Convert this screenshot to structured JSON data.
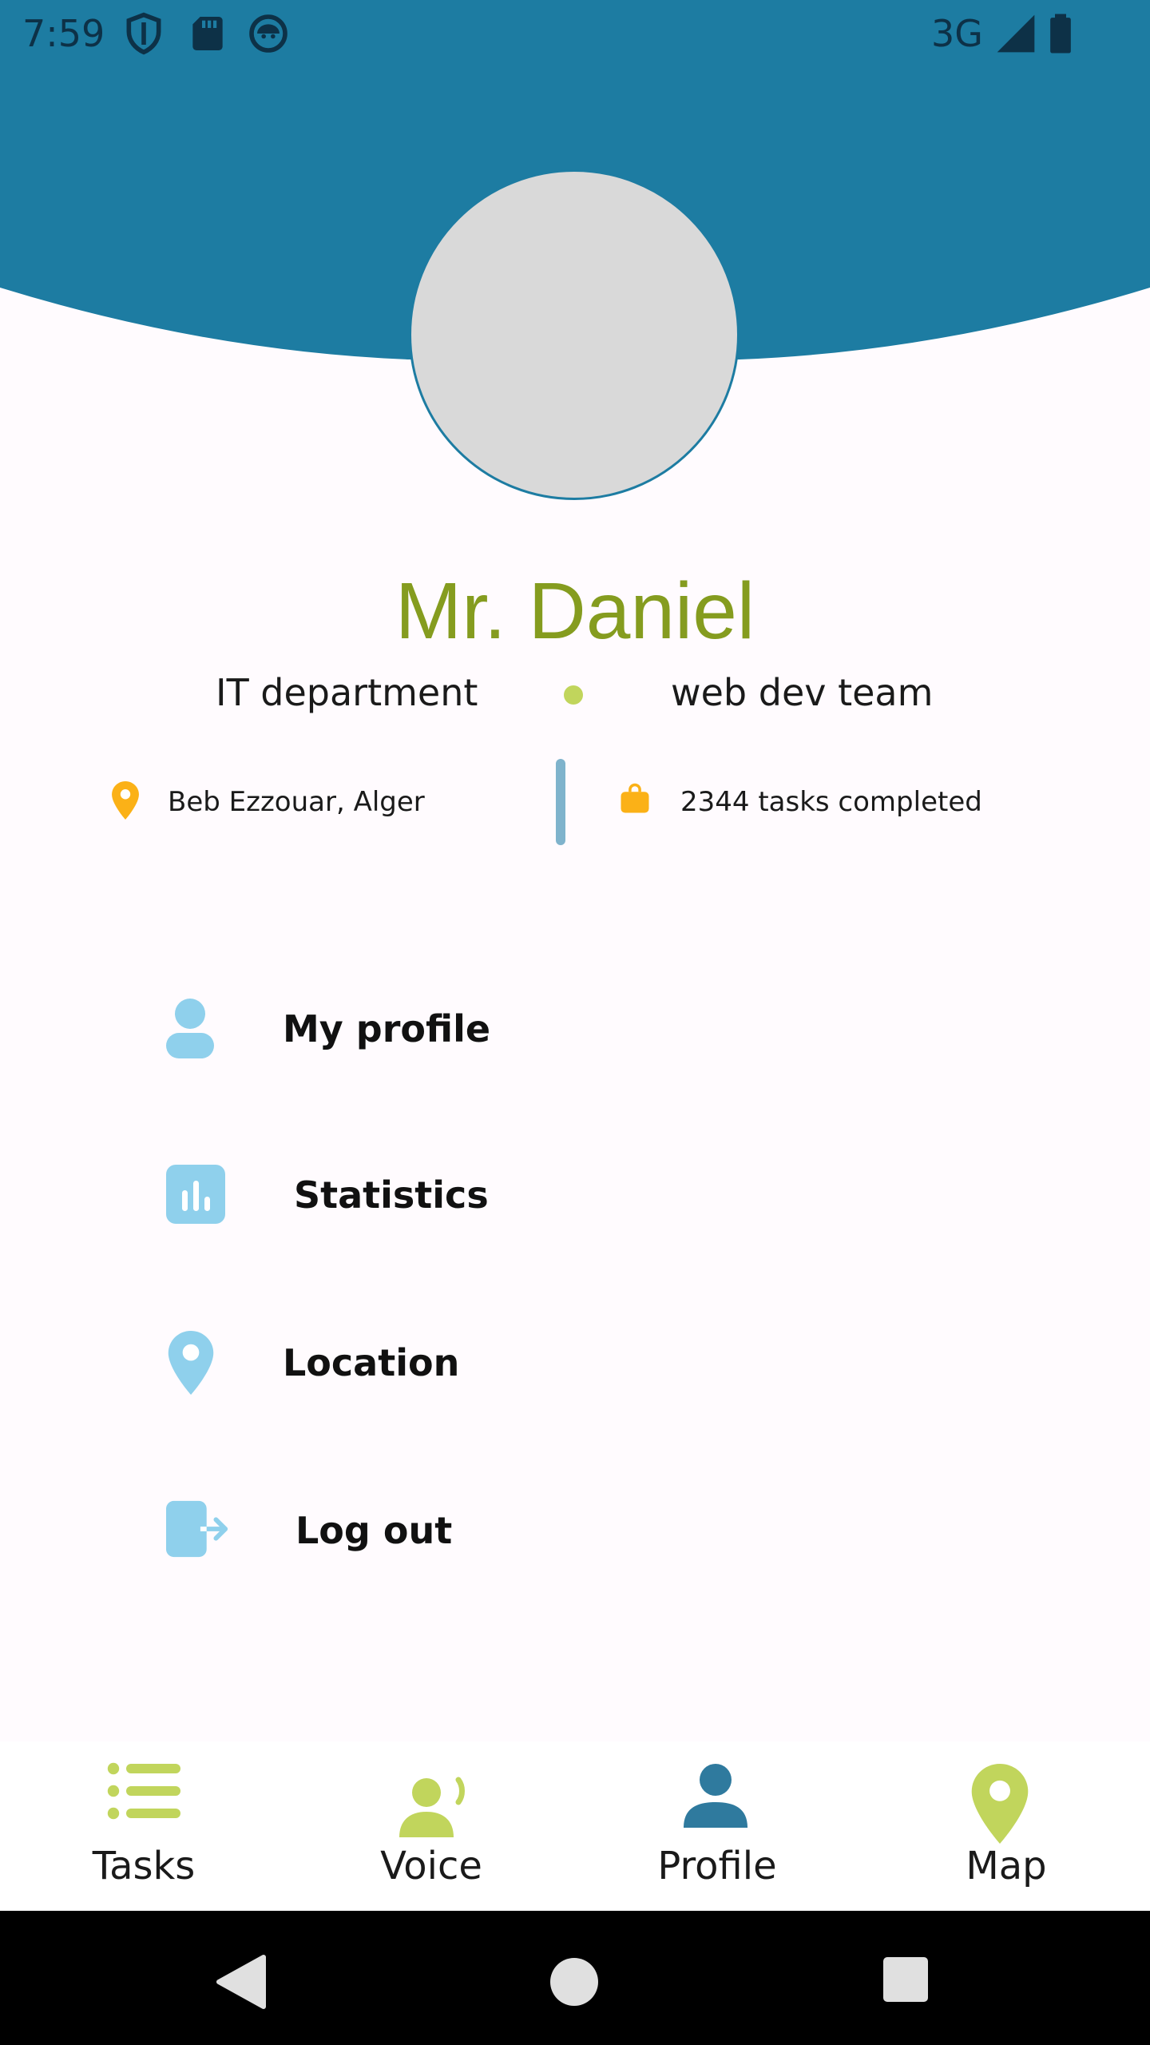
{
  "status_bar": {
    "time": "7:59",
    "network": "3G",
    "icons": [
      "shield-icon",
      "sd-card-icon",
      "android-robot-icon",
      "signal-icon",
      "battery-icon"
    ]
  },
  "profile": {
    "name": "Mr. Daniel",
    "department": "IT department",
    "team": "web dev team",
    "location": "Beb Ezzouar, Alger",
    "tasks_completed": "2344 tasks completed"
  },
  "menu": {
    "items": [
      {
        "label": "My profile",
        "icon": "person-icon"
      },
      {
        "label": "Statistics",
        "icon": "bar-chart-icon"
      },
      {
        "label": "Location",
        "icon": "location-pin-icon"
      },
      {
        "label": "Log out",
        "icon": "logout-icon"
      }
    ]
  },
  "bottom_nav": {
    "items": [
      {
        "label": "Tasks",
        "icon": "list-icon"
      },
      {
        "label": "Voice",
        "icon": "voice-person-icon"
      },
      {
        "label": "Profile",
        "icon": "person-icon",
        "selected": true
      },
      {
        "label": "Map",
        "icon": "map-pin-icon"
      }
    ]
  },
  "colors": {
    "header": "#1d7ca2",
    "name": "#859c1f",
    "accent_green": "#c1d55c",
    "accent_orange": "#fbb117",
    "menu_icon": "#8fd0ec",
    "profile_nav": "#2f7a9e"
  }
}
